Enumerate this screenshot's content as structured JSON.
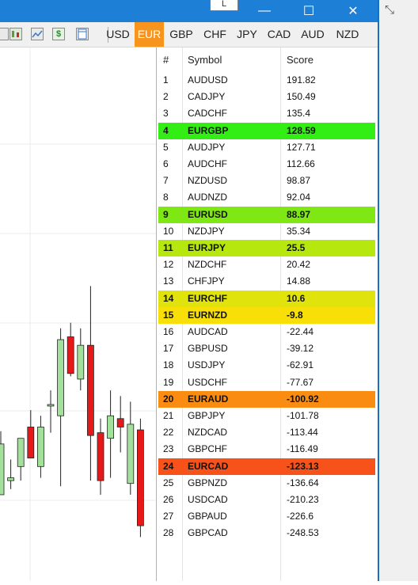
{
  "window": {
    "minimize_glyph": "—",
    "maximize_glyph": "☐",
    "close_glyph": "✕",
    "restore_glyph": "L",
    "fullscreen_icon": "expand-arrows-icon"
  },
  "toolbar": {
    "icons": [
      "settings-icon",
      "candlestick-chart-icon",
      "line-chart-icon",
      "dollar-icon",
      "template-icon"
    ],
    "currencies": [
      "USD",
      "EUR",
      "GBP",
      "CHF",
      "JPY",
      "CAD",
      "AUD",
      "NZD"
    ],
    "active_currency": "EUR",
    "active_color": "#f7941d"
  },
  "table": {
    "columns": [
      "#",
      "Symbol",
      "Score"
    ],
    "rows": [
      {
        "rank": "1",
        "symbol": "AUDUSD",
        "score": "191.82"
      },
      {
        "rank": "2",
        "symbol": "CADJPY",
        "score": "150.49"
      },
      {
        "rank": "3",
        "symbol": "CADCHF",
        "score": "135.4"
      },
      {
        "rank": "4",
        "symbol": "EURGBP",
        "score": "128.59",
        "color": "#33ee14"
      },
      {
        "rank": "5",
        "symbol": "AUDJPY",
        "score": "127.71"
      },
      {
        "rank": "6",
        "symbol": "AUDCHF",
        "score": "112.66"
      },
      {
        "rank": "7",
        "symbol": "NZDUSD",
        "score": "98.87"
      },
      {
        "rank": "8",
        "symbol": "AUDNZD",
        "score": "92.04"
      },
      {
        "rank": "9",
        "symbol": "EURUSD",
        "score": "88.97",
        "color": "#7fe714"
      },
      {
        "rank": "10",
        "symbol": "NZDJPY",
        "score": "35.34"
      },
      {
        "rank": "11",
        "symbol": "EURJPY",
        "score": "25.5",
        "color": "#b6e80f"
      },
      {
        "rank": "12",
        "symbol": "NZDCHF",
        "score": "20.42"
      },
      {
        "rank": "13",
        "symbol": "CHFJPY",
        "score": "14.88"
      },
      {
        "rank": "14",
        "symbol": "EURCHF",
        "score": "10.6",
        "color": "#e1e40c"
      },
      {
        "rank": "15",
        "symbol": "EURNZD",
        "score": "-9.8",
        "color": "#f7df07"
      },
      {
        "rank": "16",
        "symbol": "AUDCAD",
        "score": "-22.44"
      },
      {
        "rank": "17",
        "symbol": "GBPUSD",
        "score": "-39.12"
      },
      {
        "rank": "18",
        "symbol": "USDJPY",
        "score": "-62.91"
      },
      {
        "rank": "19",
        "symbol": "USDCHF",
        "score": "-77.67"
      },
      {
        "rank": "20",
        "symbol": "EURAUD",
        "score": "-100.92",
        "color": "#fb8c12"
      },
      {
        "rank": "21",
        "symbol": "GBPJPY",
        "score": "-101.78"
      },
      {
        "rank": "22",
        "symbol": "NZDCAD",
        "score": "-113.44"
      },
      {
        "rank": "23",
        "symbol": "GBPCHF",
        "score": "-116.49"
      },
      {
        "rank": "24",
        "symbol": "EURCAD",
        "score": "-123.13",
        "color": "#f6521a"
      },
      {
        "rank": "25",
        "symbol": "GBPNZD",
        "score": "-136.64"
      },
      {
        "rank": "26",
        "symbol": "USDCAD",
        "score": "-210.23"
      },
      {
        "rank": "27",
        "symbol": "GBPAUD",
        "score": "-226.6"
      },
      {
        "rank": "28",
        "symbol": "GBPCAD",
        "score": "-248.53"
      }
    ]
  },
  "chart": {
    "candles": [
      {
        "open": 1.066,
        "high": 1.075,
        "low": 1.03,
        "close": 1.03,
        "color": "up"
      },
      {
        "open": 1.04,
        "high": 1.055,
        "low": 1.034,
        "close": 1.042,
        "color": "up"
      },
      {
        "open": 1.05,
        "high": 1.06,
        "low": 1.04,
        "close": 1.07,
        "color": "up"
      },
      {
        "open": 1.078,
        "high": 1.09,
        "low": 1.06,
        "close": 1.056,
        "color": "down"
      },
      {
        "open": 1.05,
        "high": 1.086,
        "low": 1.042,
        "close": 1.078,
        "color": "up"
      },
      {
        "open": 1.094,
        "high": 1.104,
        "low": 1.074,
        "close": 1.094,
        "color": "up"
      },
      {
        "open": 1.086,
        "high": 1.148,
        "low": 1.036,
        "close": 1.14,
        "color": "up"
      },
      {
        "open": 1.142,
        "high": 1.152,
        "low": 1.114,
        "close": 1.116,
        "color": "down"
      },
      {
        "open": 1.112,
        "high": 1.148,
        "low": 1.104,
        "close": 1.136,
        "color": "up"
      },
      {
        "open": 1.136,
        "high": 1.178,
        "low": 1.04,
        "close": 1.072,
        "color": "down"
      },
      {
        "open": 1.074,
        "high": 1.084,
        "low": 1.03,
        "close": 1.04,
        "color": "down"
      },
      {
        "open": 1.07,
        "high": 1.104,
        "low": 1.042,
        "close": 1.086,
        "color": "up"
      },
      {
        "open": 1.084,
        "high": 1.1,
        "low": 1.06,
        "close": 1.078,
        "color": "down"
      },
      {
        "open": 1.08,
        "high": 1.096,
        "low": 1.03,
        "close": 1.038,
        "color": "up"
      },
      {
        "open": 1.076,
        "high": 1.084,
        "low": 1.0,
        "close": 1.008,
        "color": "down"
      }
    ]
  }
}
